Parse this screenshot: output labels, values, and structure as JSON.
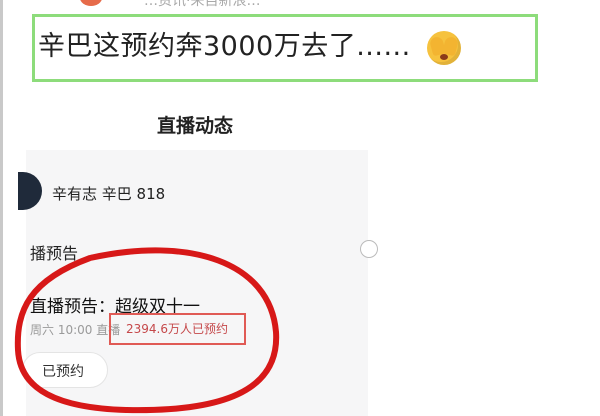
{
  "header": {
    "blurred_text": "…资讯·来自新浪…",
    "headline": "辛巴这预约奔3000万去了......"
  },
  "icons": {
    "headline_emoji": "see-no-evil-face-icon"
  },
  "live_feed": {
    "section_title": "直播动态",
    "streamer_name": "辛有志 辛巴 818",
    "preview_tag": "播预告",
    "preview_title": "直播预告：超级双十一",
    "schedule_text": "周六 10:00 直播",
    "reservation_count": "2394.6万人已预约",
    "reserved_button_label": "已预约"
  },
  "colors": {
    "headline_border": "#8ddc7b",
    "annotation_red": "#d71818",
    "count_text": "#c5484a"
  }
}
